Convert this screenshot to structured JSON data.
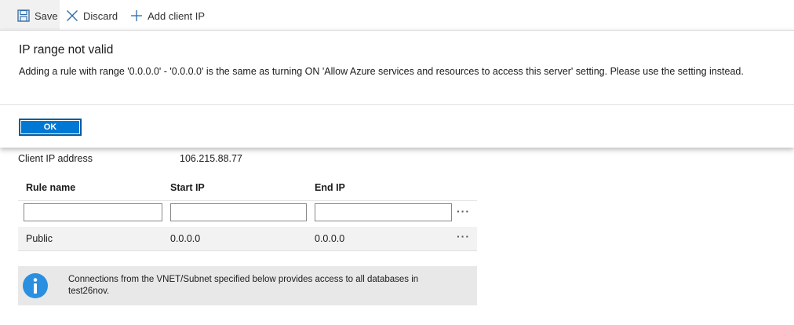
{
  "toolbar": {
    "save_label": "Save",
    "discard_label": "Discard",
    "add_client_ip_label": "Add client IP"
  },
  "dialog": {
    "title": "IP range not valid",
    "message": "Adding a rule with range '0.0.0.0' - '0.0.0.0' is the same as turning ON 'Allow Azure services and resources to access this server' setting. Please use the setting instead.",
    "ok_label": "OK"
  },
  "client_ip": {
    "label": "Client IP address",
    "value": "106.215.88.77"
  },
  "rules_table": {
    "headers": [
      "Rule name",
      "Start IP",
      "End IP"
    ],
    "new_row": {
      "rule_name": "",
      "start_ip": "",
      "end_ip": ""
    },
    "rows": [
      {
        "rule_name": "Public",
        "start_ip": "0.0.0.0",
        "end_ip": "0.0.0.0"
      }
    ],
    "more_glyph": "···"
  },
  "info": {
    "text": "Connections from the VNET/Subnet specified below provides access to all databases in test26nov."
  },
  "colors": {
    "accent": "#0078d4",
    "info_icon": "#2a8fe0",
    "info_bg": "#e8e8e8"
  }
}
